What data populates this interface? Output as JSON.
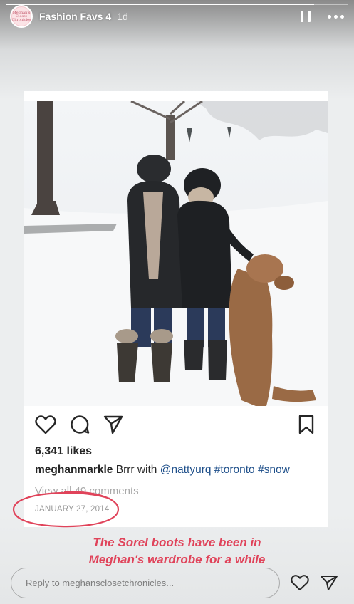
{
  "story": {
    "account_name": "Fashion Favs 4",
    "time_ago": "1d",
    "progress": 0.9,
    "avatar_text": "Meghan's Closet Chronicles"
  },
  "post": {
    "likes": "6,341 likes",
    "caption_user": "meghanmarkle",
    "caption_text": " Brrr with ",
    "caption_mention": "@nattyurq",
    "caption_tag_1": " #toronto",
    "caption_tag_2": " #snow",
    "comments_link": "View all 49 comments",
    "date": "JANUARY 27, 2014"
  },
  "sticker": {
    "line1": "The Sorel boots have been in",
    "line2": "Meghan's wardrobe for a while",
    "color": "#e0435a"
  },
  "reply": {
    "placeholder": "Reply to meghansclosetchronicles..."
  },
  "icons": {
    "pause": "pause-icon",
    "more": "more-icon",
    "like": "heart-icon",
    "comment": "comment-icon",
    "share": "send-icon",
    "save": "bookmark-icon"
  }
}
